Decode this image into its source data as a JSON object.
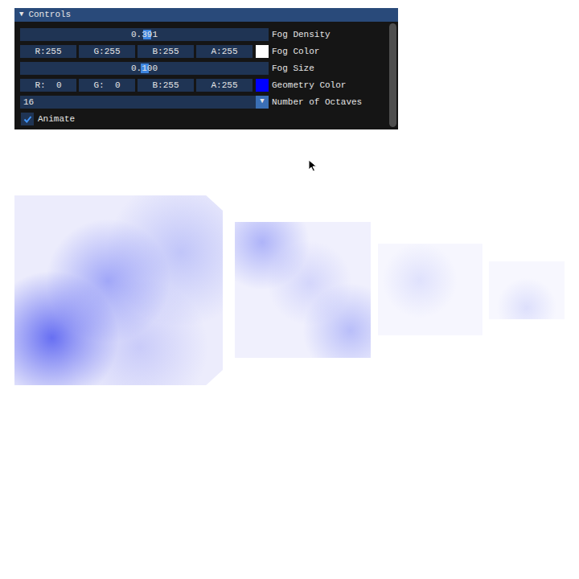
{
  "window": {
    "title": "Controls",
    "collapse_icon": "▼"
  },
  "controls": [
    {
      "kind": "slider",
      "label": "Fog Density",
      "value": "0.391",
      "level": 0.51
    },
    {
      "kind": "color",
      "label": "Fog Color",
      "components": [
        "R:255",
        "G:255",
        "B:255",
        "A:255"
      ],
      "color": "#ffffff"
    },
    {
      "kind": "slider",
      "label": "Fog Size",
      "value": "0.100",
      "level": 0.5
    },
    {
      "kind": "color",
      "label": "Geometry Color",
      "components": [
        "R:  0",
        "G:  0",
        "B:255",
        "A:255"
      ],
      "color": "#0000ff"
    },
    {
      "kind": "combo",
      "label": "Number of Octaves",
      "value": "16",
      "arrow": "▼"
    },
    {
      "kind": "checkbox",
      "label": "Animate",
      "checked": true
    }
  ]
}
